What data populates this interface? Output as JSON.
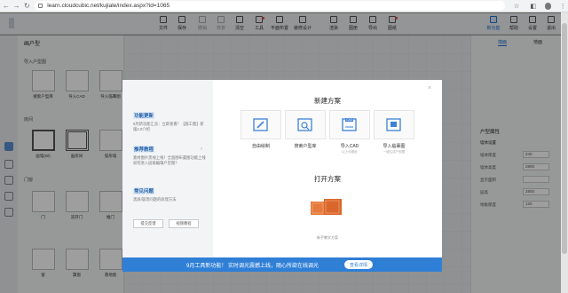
{
  "browser": {
    "url": "learn.cloudcubic.net/kujiale/index.aspx?id=1065"
  },
  "toolbar": {
    "items": [
      {
        "label": "文件"
      },
      {
        "label": "保存"
      },
      {
        "label": "撤销"
      },
      {
        "label": "恢复"
      },
      {
        "label": "清空"
      },
      {
        "label": "工具"
      },
      {
        "label": "平面布置"
      },
      {
        "label": "装修设计"
      },
      {
        "label": "渲染"
      },
      {
        "label": "图册"
      },
      {
        "label": "导出"
      },
      {
        "label": "图纸"
      }
    ],
    "right_items": [
      {
        "label": "新功能"
      },
      {
        "label": "帮助"
      },
      {
        "label": "设置"
      },
      {
        "label": "退出"
      }
    ]
  },
  "left_panel": {
    "title": "画户型",
    "section_import": "导入户型图",
    "import_items": [
      {
        "label": "搜索户型库"
      },
      {
        "label": "导入CAD"
      },
      {
        "label": "导入临摹图"
      }
    ],
    "section_room": "房间",
    "room_items": [
      {
        "label": "画墙(W)"
      },
      {
        "label": "画房间"
      },
      {
        "label": "弧形墙"
      }
    ],
    "section_door": "门窗",
    "door_items": [
      {
        "label": "门"
      },
      {
        "label": "双开门"
      },
      {
        "label": "推门"
      }
    ],
    "bottom_items": [
      {
        "label": "窗"
      },
      {
        "label": "飘窗"
      },
      {
        "label": "落地窗"
      }
    ]
  },
  "right_panel": {
    "tabs": [
      {
        "label": "墙面"
      },
      {
        "label": "地面"
      }
    ],
    "properties_title": "户型属性",
    "properties_sub": "墙体设置",
    "rows": [
      {
        "label": "墙体厚度",
        "value": "240"
      },
      {
        "label": "墙体高度",
        "value": "2800"
      },
      {
        "label": "显示面积",
        "value": ""
      },
      {
        "label": "层高",
        "value": "2800"
      },
      {
        "label": "地板厚度",
        "value": "120"
      }
    ]
  },
  "modal": {
    "side": {
      "update_heading": "功能更新",
      "update_text": "9月新功能汇总：立即查看！【施工图】新版3.0介绍",
      "tutorial_heading": "推荐教程",
      "tutorial_text": "素材图片黑线上线！全面图布置图功能上线如何进入层级编辑户型图？",
      "faq_heading": "常见问题",
      "faq_text": "黑屏/崩溃问题的处理方法",
      "btn_feedback": "提交反馈",
      "btn_video": "视频教程"
    },
    "new_title": "新建方案",
    "options": [
      {
        "label": "自由绘制",
        "sub": ""
      },
      {
        "label": "搜索户型库",
        "sub": ""
      },
      {
        "label": "导入CAD",
        "sub": "以上传图纸"
      },
      {
        "label": "导入临摹图",
        "sub": "一键生成户型图"
      }
    ],
    "cad_badge": "CAD",
    "open_title": "打开方案",
    "recent_label": "新手教学方案",
    "banner_text": "9月工具新功能！ 实时调光震撼上线，随心所欲在线调光",
    "banner_button": "查看详情"
  },
  "colors": {
    "accent": "#2f7fd6",
    "orange": "#e57a3c"
  }
}
